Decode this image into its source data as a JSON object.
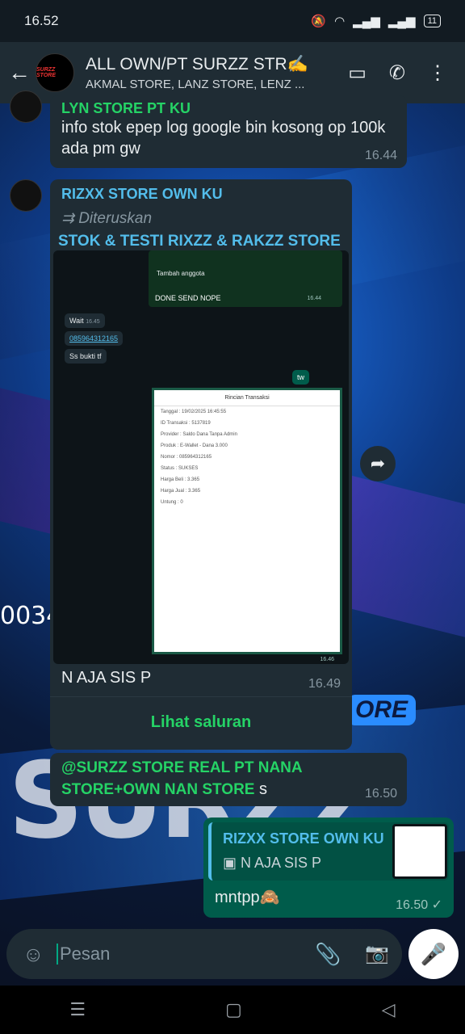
{
  "status": {
    "time": "16.52",
    "battery": "11"
  },
  "header": {
    "title": "ALL OWN/PT SURZZ STR✍️",
    "subtitle": "AKMAL STORE, LANZ STORE, LENZ ...",
    "avatar_text": "SURZZ STORE"
  },
  "background": {
    "number_text": "0034",
    "store_text": "ORE"
  },
  "messages": [
    {
      "sender": "LYN STORE PT KU",
      "text": "info stok epep log google bin kosong op 100k ada pm gw",
      "time": "16.44"
    },
    {
      "sender": "RIZXX STORE OWN KU",
      "forwarded": "Diteruskan",
      "channel": "STOK & TESTI RIXZZ & RAKZZ STORE",
      "caption": "N AJA SIS P",
      "time": "16.49",
      "action": "Lihat saluran",
      "screenshot": {
        "top_label": "Tambah anggota",
        "done": "DONE SEND NOPE",
        "done_time": "16.44",
        "wait": "Wait",
        "wait_time": "16.45",
        "number": "085964312165",
        "bukti": "Ss bukti tf",
        "tw": "tw",
        "doc_title": "Rincian Transaksi",
        "rows": [
          "Tanggal : 19/02/2025 16:45:55",
          "ID Transaksi : 5137819",
          "Provider : Saldo Dana Tanpa Admin",
          "Produk : E-Wallet - Dana 3.000",
          "Nomor : 085964312165",
          "Status : SUKSES",
          "Harga Beli : 3.365",
          "Harga Jual : 3.365",
          "Untung : 0"
        ],
        "doc_time": "16.46"
      }
    },
    {
      "mention": "@SURZZ STORE REAL PT NANA STORE+OWN NAN STORE",
      "text": " s",
      "time": "16.50"
    },
    {
      "quote_sender": "RIZXX STORE OWN KU",
      "quote_text": "N AJA SIS P",
      "text": "mntpp🙈",
      "time": "16.50 ✓"
    }
  ],
  "input": {
    "placeholder": "Pesan"
  }
}
